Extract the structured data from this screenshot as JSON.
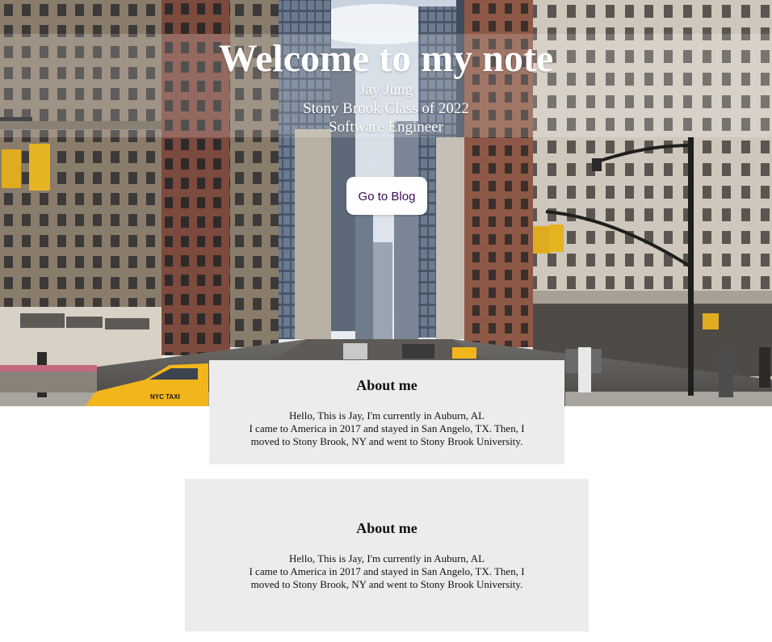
{
  "hero": {
    "title": "Welcome to my note",
    "name": "Jay Jung",
    "school": "Stony Brook Class of 2022",
    "role": "Software Engineer",
    "button_label": "Go to Blog",
    "taxi_sign": "NYC TAXI"
  },
  "cards": [
    {
      "heading": "About me",
      "line1": "Hello, This is Jay, I'm currently in Auburn, AL",
      "line2": "I came to America in 2017 and stayed in San Angelo, TX. Then, I",
      "line3": "moved to Stony Brook, NY and went to Stony Brook University."
    },
    {
      "heading": "About me",
      "line1": "Hello, This is Jay, I'm currently in Auburn, AL",
      "line2": "I came to America in 2017 and stayed in San Angelo, TX. Then, I",
      "line3": "moved to Stony Brook, NY and went to Stony Brook University."
    }
  ],
  "colors": {
    "card_bg": "#ececec",
    "button_text": "#3a0a55",
    "hero_text": "#ffffff"
  }
}
